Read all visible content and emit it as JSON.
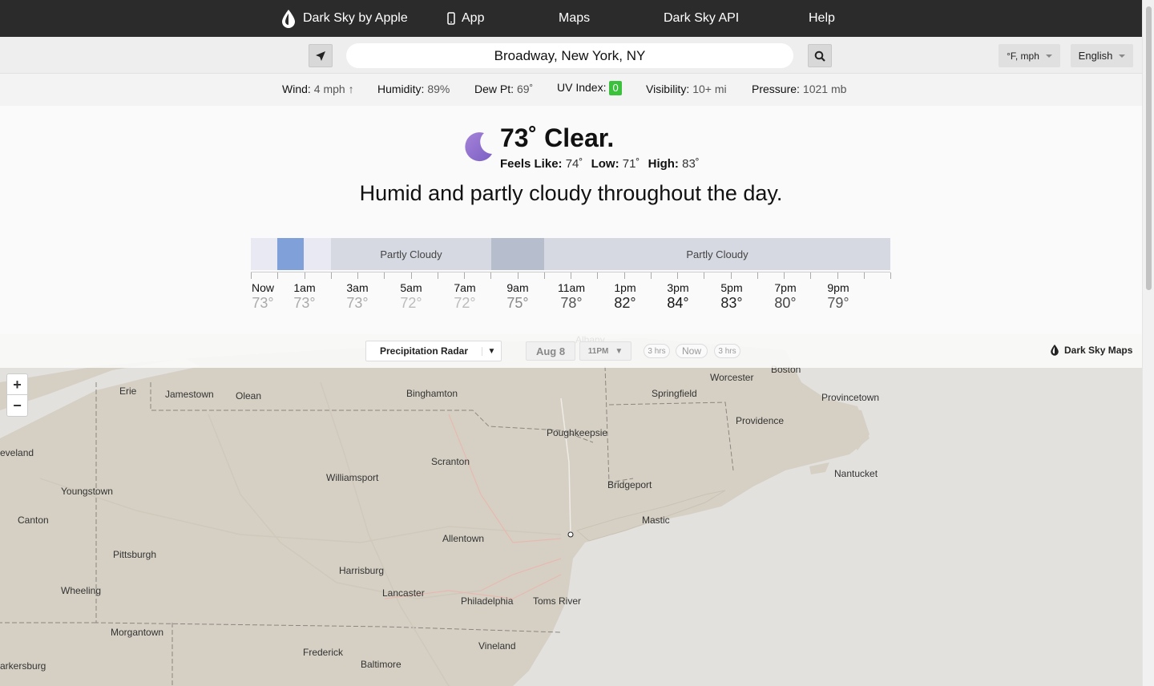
{
  "nav": {
    "brand": "Dark Sky by Apple",
    "app": "App",
    "maps": "Maps",
    "api": "Dark Sky API",
    "help": "Help"
  },
  "search": {
    "value": "Broadway, New York, NY",
    "units": "°F, mph",
    "language": "English"
  },
  "conditions": {
    "wind_label": "Wind:",
    "wind_value": "4 mph ↑",
    "humidity_label": "Humidity:",
    "humidity_value": "89%",
    "dew_label": "Dew Pt:",
    "dew_value": "69˚",
    "uv_label": "UV Index:",
    "uv_value": "0",
    "visibility_label": "Visibility:",
    "visibility_value": "10+ mi",
    "pressure_label": "Pressure:",
    "pressure_value": "1021 mb"
  },
  "current": {
    "headline": "73˚ Clear.",
    "feels_label": "Feels Like:",
    "feels_value": "74˚",
    "low_label": "Low:",
    "low_value": "71˚",
    "high_label": "High:",
    "high_value": "83˚",
    "summary": "Humid and partly cloudy throughout the day."
  },
  "timeline": {
    "segments": [
      {
        "label": "",
        "color": "#e9e9f3"
      },
      {
        "label": "",
        "color": "#7fa0d8"
      },
      {
        "label": "",
        "color": "#e9e9f3"
      },
      {
        "label": "Partly Cloudy",
        "color": "#d6d9e2"
      },
      {
        "label": "",
        "color": "#b6bdcc"
      },
      {
        "label": "Partly Cloudy",
        "color": "#d6d9e2"
      }
    ],
    "hours": [
      {
        "label": "Now",
        "temp": "73°",
        "color": "#aaaaaa"
      },
      {
        "label": "1am",
        "temp": "73°",
        "color": "#aaaaaa"
      },
      {
        "label": "3am",
        "temp": "73°",
        "color": "#aaaaaa"
      },
      {
        "label": "5am",
        "temp": "72°",
        "color": "#bbbbbb"
      },
      {
        "label": "7am",
        "temp": "72°",
        "color": "#bbbbbb"
      },
      {
        "label": "9am",
        "temp": "75°",
        "color": "#888888"
      },
      {
        "label": "11am",
        "temp": "78°",
        "color": "#555555"
      },
      {
        "label": "1pm",
        "temp": "82°",
        "color": "#222222"
      },
      {
        "label": "3pm",
        "temp": "84°",
        "color": "#111111"
      },
      {
        "label": "5pm",
        "temp": "83°",
        "color": "#222222"
      },
      {
        "label": "7pm",
        "temp": "80°",
        "color": "#444444"
      },
      {
        "label": "9pm",
        "temp": "79°",
        "color": "#555555"
      }
    ]
  },
  "map": {
    "layer": "Precipitation Radar",
    "date": "Aug 8",
    "time": "11PM",
    "back": "3 hrs",
    "now": "Now",
    "forward": "3 hrs",
    "brand": "Dark Sky Maps",
    "zoom_in": "+",
    "zoom_out": "−",
    "cities": [
      {
        "name": "Albany"
      },
      {
        "name": "Boston"
      },
      {
        "name": "Worcester"
      },
      {
        "name": "Erie"
      },
      {
        "name": "Jamestown"
      },
      {
        "name": "Olean"
      },
      {
        "name": "Binghamton"
      },
      {
        "name": "Springfield"
      },
      {
        "name": "Provincetown"
      },
      {
        "name": "Providence"
      },
      {
        "name": "Poughkeepsie"
      },
      {
        "name": "eveland"
      },
      {
        "name": "Scranton"
      },
      {
        "name": "Williamsport"
      },
      {
        "name": "Nantucket"
      },
      {
        "name": "Youngstown"
      },
      {
        "name": "Bridgeport"
      },
      {
        "name": "Canton"
      },
      {
        "name": "Mastic"
      },
      {
        "name": "Allentown"
      },
      {
        "name": "Pittsburgh"
      },
      {
        "name": "Harrisburg"
      },
      {
        "name": "Wheeling"
      },
      {
        "name": "Lancaster"
      },
      {
        "name": "Philadelphia"
      },
      {
        "name": "Toms River"
      },
      {
        "name": "Morgantown"
      },
      {
        "name": "Vineland"
      },
      {
        "name": "Frederick"
      },
      {
        "name": "Baltimore"
      },
      {
        "name": "arkersburg"
      }
    ]
  }
}
